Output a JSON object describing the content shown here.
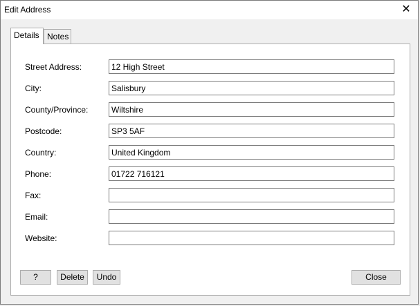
{
  "window": {
    "title": "Edit Address",
    "close_glyph": "✕"
  },
  "tabs": [
    {
      "label": "Details",
      "active": true
    },
    {
      "label": "Notes",
      "active": false
    }
  ],
  "form": {
    "fields": [
      {
        "label": "Street Address:",
        "value": "12 High Street"
      },
      {
        "label": "City:",
        "value": "Salisbury"
      },
      {
        "label": "County/Province:",
        "value": "Wiltshire"
      },
      {
        "label": "Postcode:",
        "value": "SP3 5AF"
      },
      {
        "label": "Country:",
        "value": "United Kingdom"
      },
      {
        "label": "Phone:",
        "value": "01722 716121"
      },
      {
        "label": "Fax:",
        "value": ""
      },
      {
        "label": "Email:",
        "value": ""
      },
      {
        "label": "Website:",
        "value": ""
      }
    ]
  },
  "buttons": {
    "help": "?",
    "delete": "Delete",
    "undo": "Undo",
    "close": "Close"
  }
}
